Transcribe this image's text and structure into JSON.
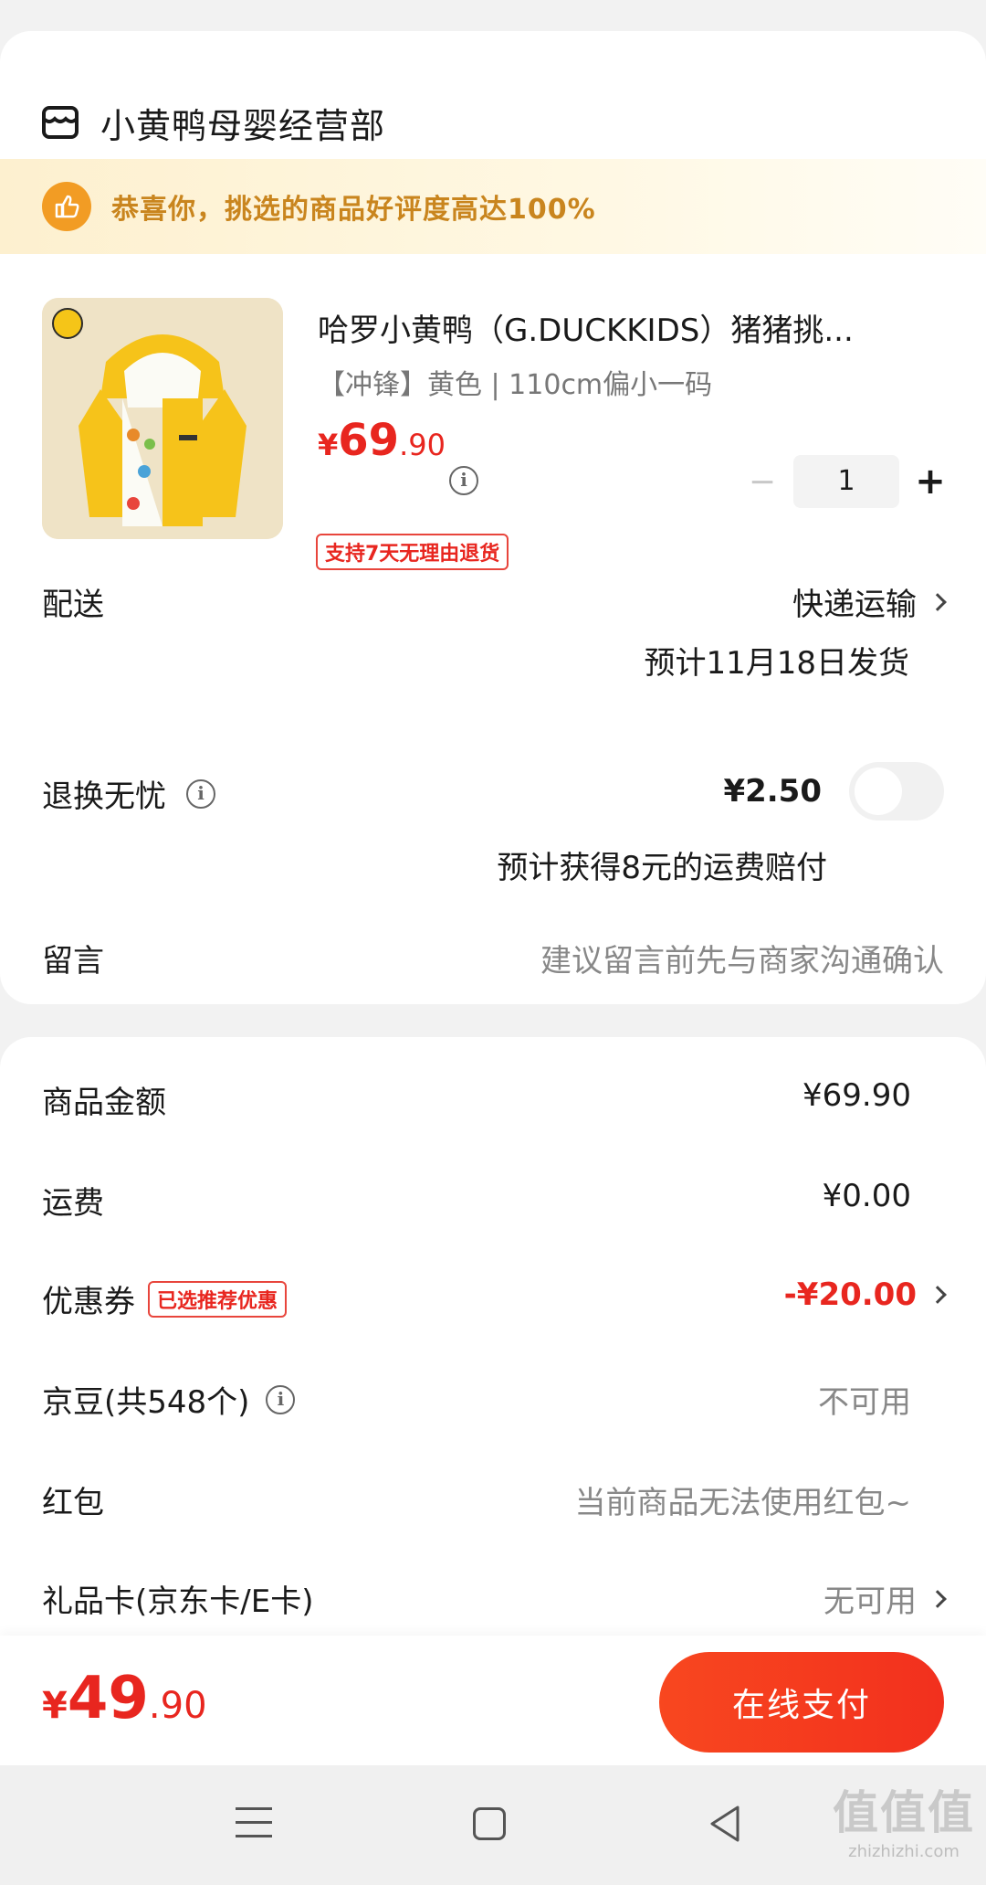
{
  "store": {
    "name": "小黄鸭母婴经营部",
    "icon": "store-icon"
  },
  "banner": {
    "text": "恭喜你，挑选的商品好评度高达100%",
    "icon": "thumbs-up-icon",
    "accent": "#f29c24"
  },
  "product": {
    "title": "哈罗小黄鸭（G.DUCKKIDS）猪猪挑...",
    "spec": "【冲锋】黄色 | 110cm偏小一码",
    "price_symbol": "¥",
    "price_int": "69",
    "price_dec": ".90",
    "quantity": "1",
    "minus": "−",
    "plus": "+",
    "return_tag": "支持7天无理由退货"
  },
  "delivery": {
    "label": "配送",
    "method": "快递运输",
    "eta": "预计11月18日发货"
  },
  "return_insurance": {
    "label": "退换无忧",
    "price": "¥2.50",
    "note": "预计获得8元的运费赔付",
    "toggle_on": false
  },
  "message": {
    "label": "留言",
    "placeholder": "建议留言前先与商家沟通确认"
  },
  "summary": {
    "goods": {
      "label": "商品金额",
      "value": "¥69.90"
    },
    "shipping": {
      "label": "运费",
      "value": "¥0.00"
    },
    "coupon": {
      "label": "优惠券",
      "tag": "已选推荐优惠",
      "value": "-¥20.00"
    },
    "beans": {
      "label": "京豆(共548个)",
      "value": "不可用"
    },
    "redpacket": {
      "label": "红包",
      "value": "当前商品无法使用红包~"
    },
    "giftcard": {
      "label": "礼品卡(京东卡/E卡)",
      "value": "无可用"
    }
  },
  "footer": {
    "total_symbol": "¥",
    "total_int": "49",
    "total_dec": ".90",
    "pay_label": "在线支付"
  },
  "watermark": {
    "big": "值值值",
    "small": "zhizhizhi.com"
  },
  "colors": {
    "brand_red": "#e8261f",
    "banner_bg": "#fdf0cf",
    "banner_text": "#c9851e"
  }
}
